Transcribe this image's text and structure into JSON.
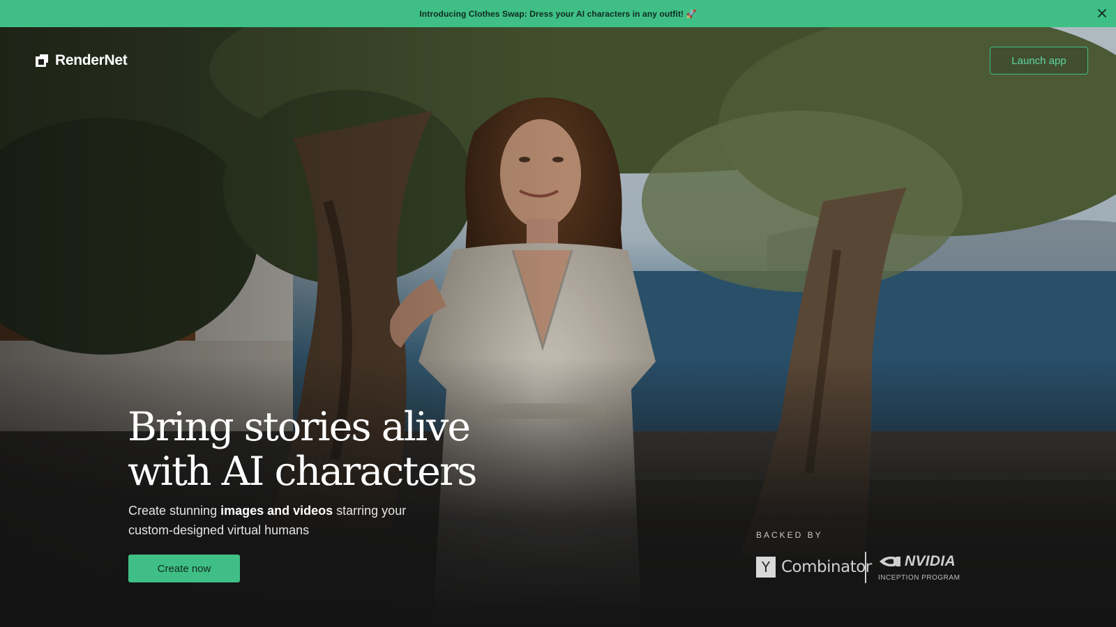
{
  "announcement": {
    "text": "Introducing Clothes Swap: Dress your AI characters in any outfit! 🚀",
    "close_icon": "close-icon"
  },
  "brand": {
    "name": "RenderNet",
    "logo_icon": "rendernet-logo-icon",
    "accent_color": "#3fbf86"
  },
  "nav": {
    "launch_label": "Launch app"
  },
  "hero": {
    "headline_line1": "Bring stories alive",
    "headline_line2": "with AI characters",
    "sub_pre": "Create stunning ",
    "sub_bold": "images and videos",
    "sub_post": " starring your custom-designed virtual humans",
    "cta_label": "Create now",
    "background_image": "woman in white lace dress leaning on olive tree by the sea"
  },
  "backers": {
    "heading": "BACKED BY",
    "yc_letter": "Y",
    "yc_name": "Combinator",
    "nvidia_name": "NVIDIA",
    "nvidia_program": "INCEPTION PROGRAM"
  }
}
